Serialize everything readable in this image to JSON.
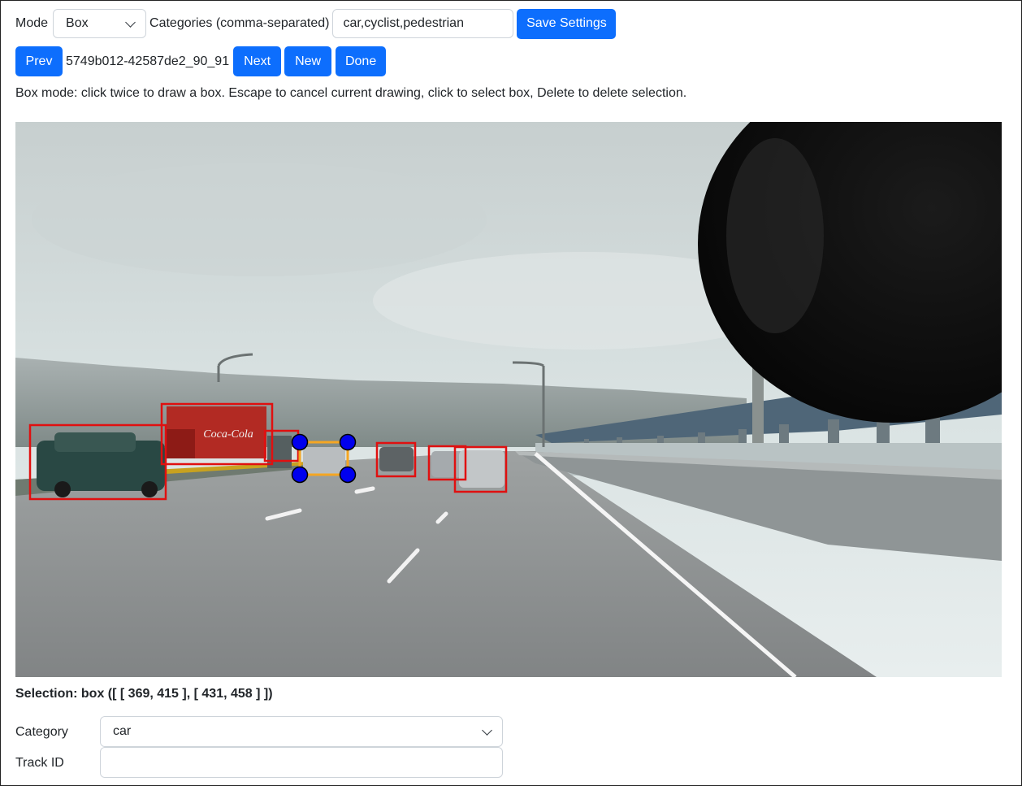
{
  "toolbar": {
    "mode_label": "Mode",
    "mode_value": "Box",
    "categories_label": "Categories (comma-separated)",
    "categories_value": "car,cyclist,pedestrian",
    "save_label": "Save Settings"
  },
  "nav": {
    "prev_label": "Prev",
    "image_id": "5749b012-42587de2_90_91",
    "next_label": "Next",
    "new_label": "New",
    "done_label": "Done"
  },
  "help_text": "Box mode: click twice to draw a box. Escape to cancel current drawing, click to select box, Delete to delete selection.",
  "selection_text": "Selection: box ([ [ 369, 415 ], [ 431, 458 ] ])",
  "form": {
    "category_label": "Category",
    "category_value": "car",
    "track_label": "Track ID",
    "track_value": ""
  },
  "colors": {
    "primary": "#0d6efd",
    "box": "#e01010",
    "selected_box": "#f5a623",
    "handle": "#0000ee"
  },
  "scene": {
    "truck_logo": "Coca-Cola"
  }
}
